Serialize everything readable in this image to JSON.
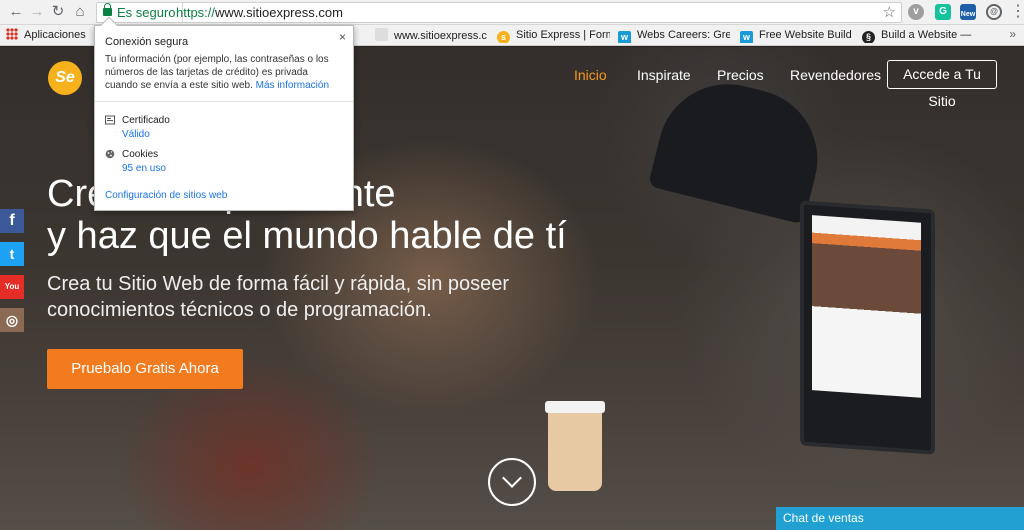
{
  "browser": {
    "secure_label": "Es seguro",
    "url_scheme": "https://",
    "url_host": "www.sitioexpress.com",
    "bookmarks": [
      {
        "label": "Aplicaciones"
      },
      {
        "label": "www.sitioexpress.com"
      },
      {
        "label": "Sitio Express | Formul"
      },
      {
        "label": "Webs Careers: Great"
      },
      {
        "label": "Free Website Builder"
      },
      {
        "label": "Build a Website — So"
      }
    ],
    "extension_badge": "New"
  },
  "popup": {
    "title": "Conexión segura",
    "description": "Tu información (por ejemplo, las contraseñas o los números de las tarjetas de crédito) es privada cuando se envía a este sitio web.",
    "more_link": "Más información",
    "certificate_label": "Certificado",
    "certificate_value": "Válido",
    "cookies_label": "Cookies",
    "cookies_value": "95 en uso",
    "settings_link": "Configuración de sitios web",
    "close_glyph": "×"
  },
  "site": {
    "nav": [
      {
        "label": "Inicio",
        "active": true
      },
      {
        "label": "Inspirate"
      },
      {
        "label": "Precios"
      },
      {
        "label": "Revendedores"
      }
    ],
    "access_button": "Accede a Tu Sitio",
    "hero_title_line1": "Crea o sorprendente",
    "hero_title_line2": "y haz que el mundo hable de tí",
    "hero_subtitle": "Crea tu Sitio Web de forma fácil y rápida, sin poseer conocimientos técnicos o de programación.",
    "cta_button": "Pruebalo Gratis Ahora",
    "chat_label": "Chat de ventas",
    "social": [
      {
        "name": "facebook-icon",
        "glyph": "f",
        "color": "#3b5998"
      },
      {
        "name": "twitter-icon",
        "glyph": "t",
        "color": "#1da1f2"
      },
      {
        "name": "youtube-icon",
        "glyph": "You",
        "color": "#e52d27"
      },
      {
        "name": "instagram-icon",
        "glyph": "◎",
        "color": "#8a6a52"
      }
    ]
  },
  "colors": {
    "accent": "#f27b20",
    "nav_active": "#f39a1e",
    "secure_green": "#0b8043",
    "link_blue": "#1a73e8",
    "chat": "#21a0d2"
  }
}
